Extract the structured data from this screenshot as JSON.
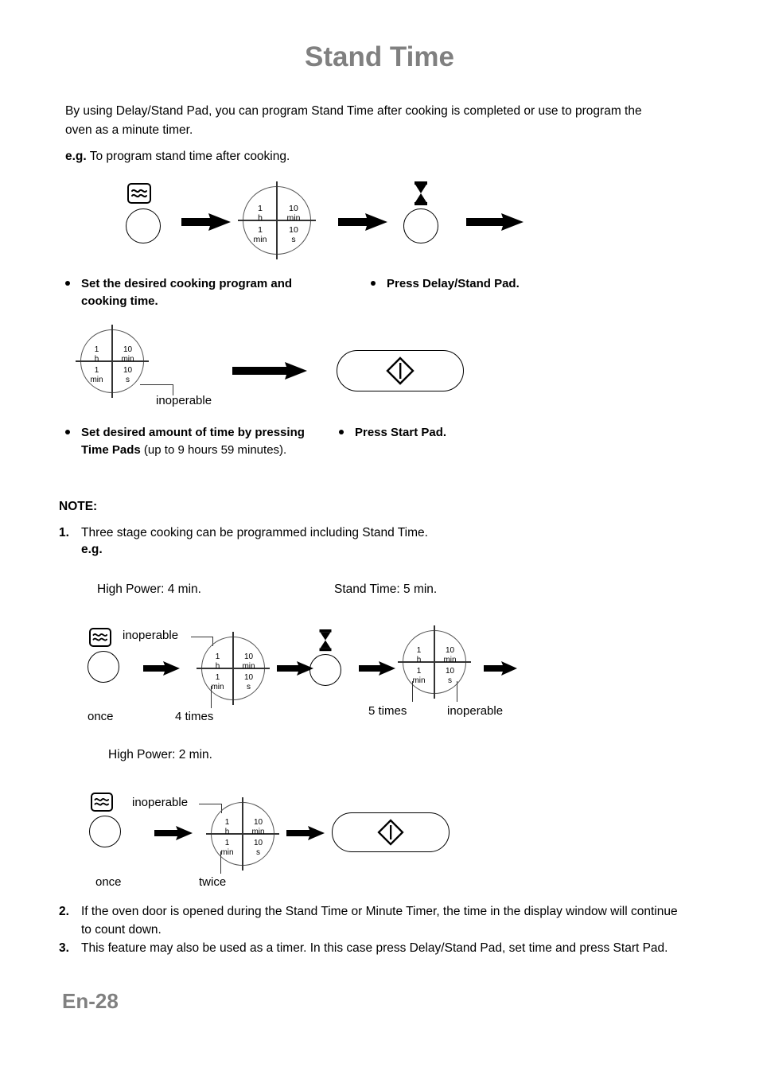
{
  "document": {
    "title": "Stand Time",
    "page_number": "En-28",
    "intro": "By using Delay/Stand Pad, you can program Stand Time after cooking is completed or use to program the oven as a minute timer.",
    "eg_prefix": "e.g.",
    "eg_text": " To program stand time after cooking."
  },
  "timepad": {
    "q_top_left_num": "1",
    "q_top_left_unit": "h",
    "q_top_right_num": "10",
    "q_top_right_unit": "min",
    "q_bottom_left_num": "1",
    "q_bottom_left_unit": "min",
    "q_bottom_right_num": "10",
    "q_bottom_right_unit": "s"
  },
  "steps": {
    "step1_bullet": "Set the desired cooking program and cooking time.",
    "step2_bullet": "Press Delay/Stand Pad.",
    "step3_bold": "Set desired amount of time by pressing Time Pads",
    "step3_rest": " (up to 9 hours 59 minutes).",
    "step4_bullet": "Press Start Pad.",
    "inoperable_label": "inoperable"
  },
  "note": {
    "heading": "NOTE:",
    "item1_num": "1.",
    "item1_text": "Three stage cooking can be programmed including Stand Time.",
    "item1_eg": "e.g.",
    "item2_num": "2.",
    "item2_text": "If the oven door is opened during the Stand Time or Minute Timer, the time in the display window will continue to count down.",
    "item3_num": "3.",
    "item3_text": "This feature may also be used as a timer. In this case press Delay/Stand Pad, set time and press Start Pad."
  },
  "example": {
    "stage1_label": "High Power: 4 min.",
    "stage2_label": "Stand Time: 5 min.",
    "stage3_label": "High Power: 2 min.",
    "once_a": "once",
    "four_times": "4 times",
    "inoperable_a": "inoperable",
    "five_times": "5 times",
    "inoperable_b": "inoperable",
    "once_b": "once",
    "twice": "twice",
    "inoperable_c": "inoperable"
  },
  "icons": {
    "microwave": "microwave-wave-icon",
    "hourglass": "hourglass-icon",
    "start": "start-diamond-icon",
    "arrow": "right-arrow-icon"
  },
  "colors": {
    "title_gray": "#808080",
    "ink": "#000000",
    "line": "#333333"
  }
}
